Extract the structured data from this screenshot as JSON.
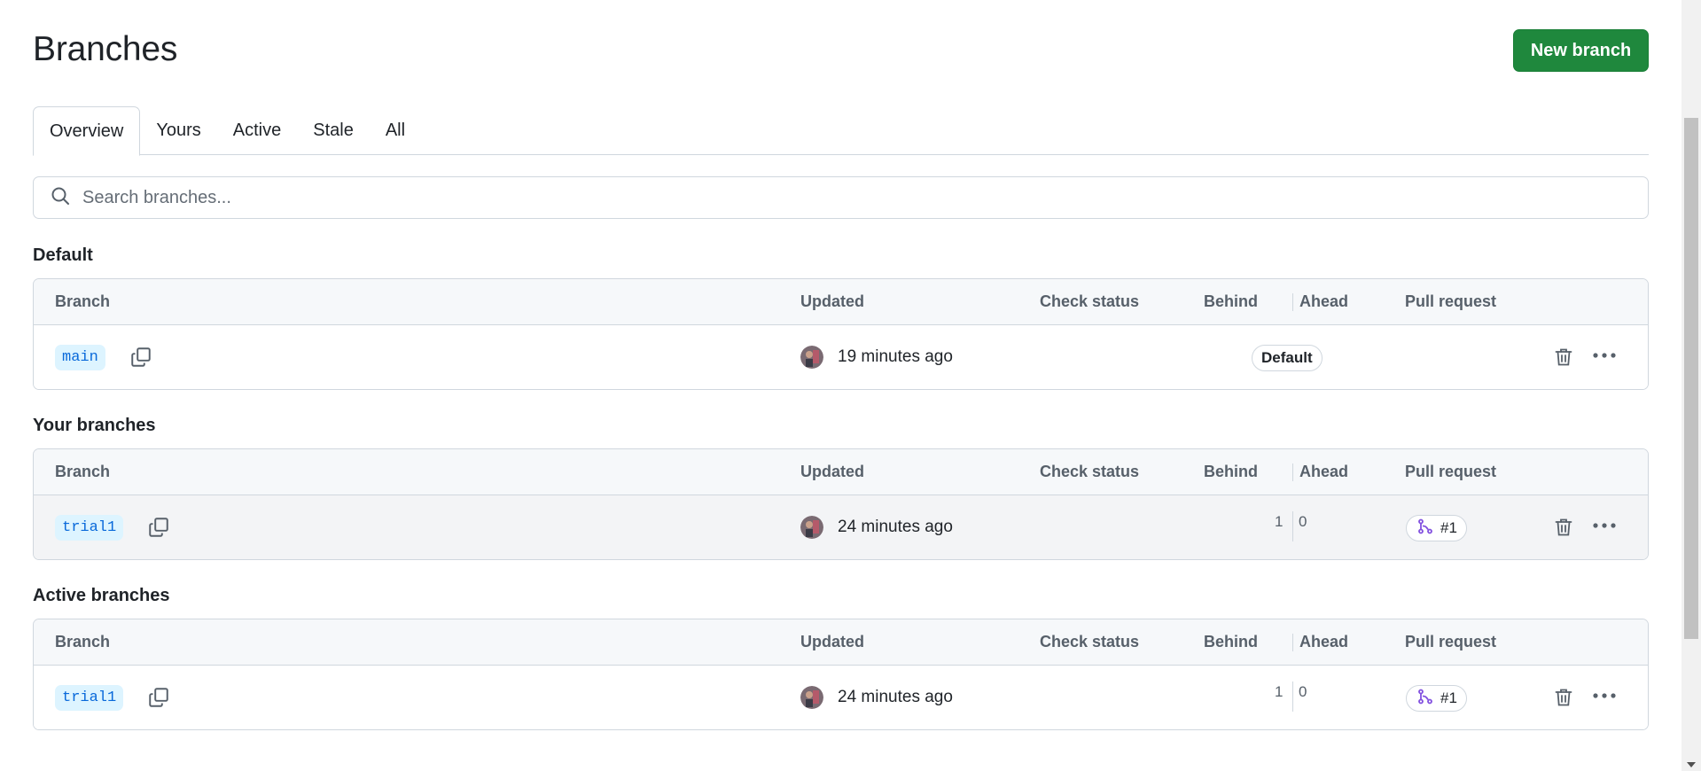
{
  "header": {
    "title": "Branches",
    "new_branch_label": "New branch"
  },
  "tabs": [
    {
      "label": "Overview",
      "selected": true
    },
    {
      "label": "Yours",
      "selected": false
    },
    {
      "label": "Active",
      "selected": false
    },
    {
      "label": "Stale",
      "selected": false
    },
    {
      "label": "All",
      "selected": false
    }
  ],
  "search": {
    "placeholder": "Search branches...",
    "value": ""
  },
  "columns": {
    "branch": "Branch",
    "updated": "Updated",
    "check_status": "Check status",
    "behind": "Behind",
    "ahead": "Ahead",
    "pull_request": "Pull request"
  },
  "sections": {
    "default": {
      "title": "Default",
      "row": {
        "branch": "main",
        "updated": "19 minutes ago",
        "badge": "Default"
      }
    },
    "yours": {
      "title": "Your branches",
      "row": {
        "branch": "trial1",
        "updated": "24 minutes ago",
        "behind": "1",
        "ahead": "0",
        "pr": "#1"
      }
    },
    "active": {
      "title": "Active branches",
      "row": {
        "branch": "trial1",
        "updated": "24 minutes ago",
        "behind": "1",
        "ahead": "0",
        "pr": "#1"
      }
    }
  },
  "icons": {
    "search": "search-icon",
    "copy": "copy-icon",
    "trash": "trash-icon",
    "more": "kebab-horizontal-icon",
    "pr": "git-pull-request-icon"
  },
  "colors": {
    "primary_button": "#1f883d",
    "branch_chip_bg": "#ddf4ff",
    "branch_chip_text": "#0969da",
    "pr_icon": "#8250df",
    "border": "#d0d7de",
    "header_bg": "#f6f8fa"
  }
}
